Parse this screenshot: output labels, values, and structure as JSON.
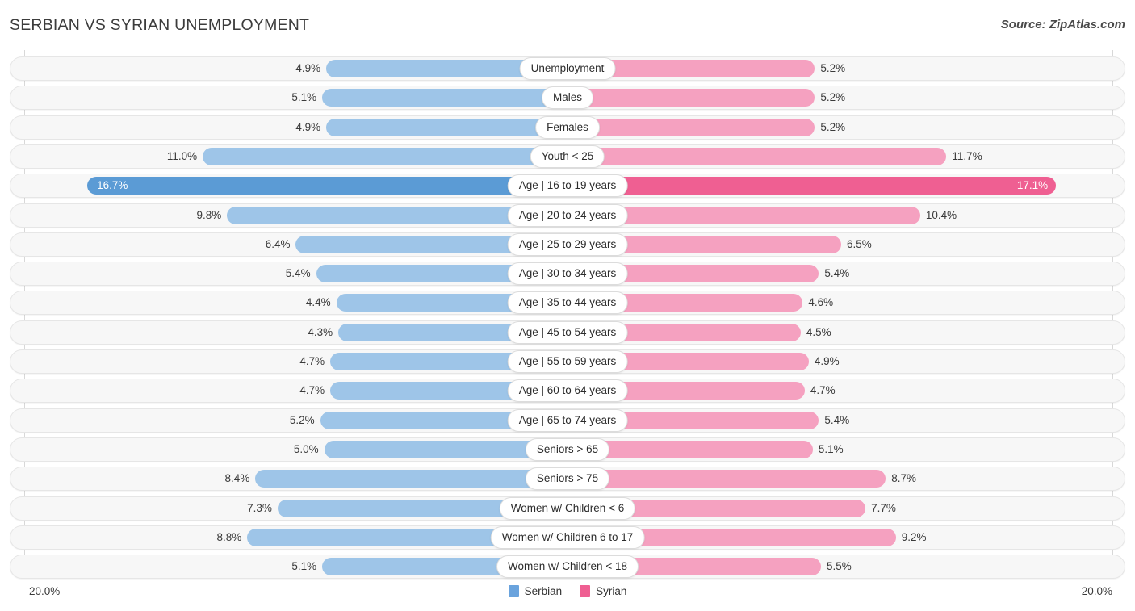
{
  "header": {
    "title": "SERBIAN VS SYRIAN UNEMPLOYMENT",
    "source": "Source: ZipAtlas.com"
  },
  "axis": {
    "left_tick": "20.0%",
    "right_tick": "20.0%",
    "max": 20.0
  },
  "legend": [
    {
      "label": "Serbian",
      "color": "#6aa3dd"
    },
    {
      "label": "Syrian",
      "color": "#ef5f92"
    }
  ],
  "colors": {
    "serbian_light": "#9ec5e8",
    "serbian_dark": "#5b9bd5",
    "syrian_light": "#f5a1c0",
    "syrian_dark": "#ef5f92",
    "track_bg": "#f7f7f7",
    "track_border": "#e6e6e6",
    "pill_bg": "#ffffff",
    "pill_border": "#dcdcdc",
    "text": "#3a3a3a"
  },
  "chart_data": {
    "type": "bar",
    "title": "SERBIAN VS SYRIAN UNEMPLOYMENT",
    "subtitle": "",
    "orientation": "horizontal-diverging",
    "xlabel": "",
    "ylabel": "",
    "xlim": [
      20.0,
      20.0
    ],
    "grid": false,
    "legend_position": "bottom-center",
    "categories": [
      "Unemployment",
      "Males",
      "Females",
      "Youth < 25",
      "Age | 16 to 19 years",
      "Age | 20 to 24 years",
      "Age | 25 to 29 years",
      "Age | 30 to 34 years",
      "Age | 35 to 44 years",
      "Age | 45 to 54 years",
      "Age | 55 to 59 years",
      "Age | 60 to 64 years",
      "Age | 65 to 74 years",
      "Seniors > 65",
      "Seniors > 75",
      "Women w/ Children < 6",
      "Women w/ Children 6 to 17",
      "Women w/ Children < 18"
    ],
    "series": [
      {
        "name": "Serbian",
        "side": "left",
        "values": [
          4.9,
          5.1,
          4.9,
          11.0,
          16.7,
          9.8,
          6.4,
          5.4,
          4.4,
          4.3,
          4.7,
          4.7,
          5.2,
          5.0,
          8.4,
          7.3,
          8.8,
          5.1
        ],
        "labels": [
          "4.9%",
          "5.1%",
          "4.9%",
          "11.0%",
          "16.7%",
          "9.8%",
          "6.4%",
          "5.4%",
          "4.4%",
          "4.3%",
          "4.7%",
          "4.7%",
          "5.2%",
          "5.0%",
          "8.4%",
          "7.3%",
          "8.8%",
          "5.1%"
        ]
      },
      {
        "name": "Syrian",
        "side": "right",
        "values": [
          5.2,
          5.2,
          5.2,
          11.7,
          17.1,
          10.4,
          6.5,
          5.4,
          4.6,
          4.5,
          4.9,
          4.7,
          5.4,
          5.1,
          8.7,
          7.7,
          9.2,
          5.5
        ],
        "labels": [
          "5.2%",
          "5.2%",
          "5.2%",
          "11.7%",
          "17.1%",
          "10.4%",
          "6.5%",
          "5.4%",
          "4.6%",
          "4.5%",
          "4.9%",
          "4.7%",
          "5.4%",
          "5.1%",
          "8.7%",
          "7.7%",
          "9.2%",
          "5.5%"
        ]
      }
    ],
    "highlighted_row_index": 4
  }
}
